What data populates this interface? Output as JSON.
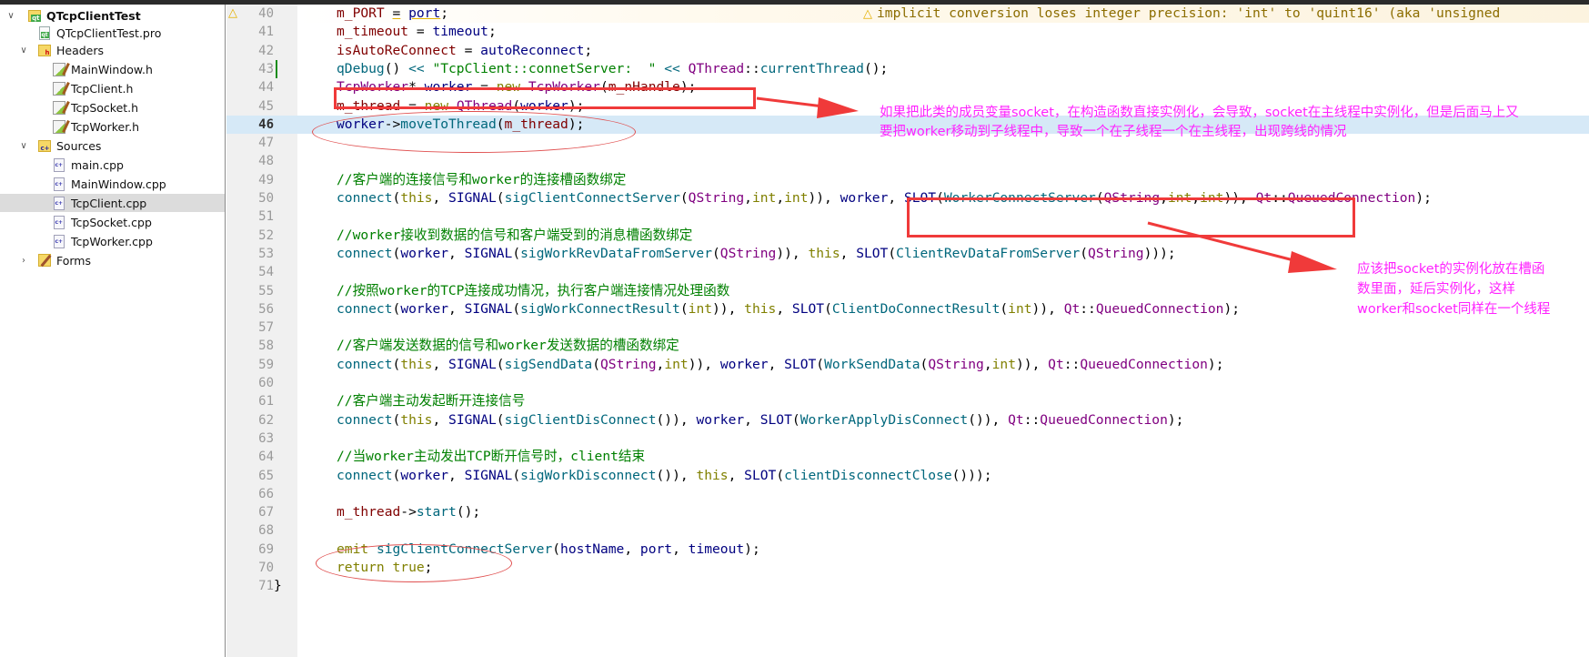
{
  "project_tree": {
    "root": {
      "label": "QTcpClientTest",
      "icon": "qt-project-icon"
    },
    "items": [
      {
        "label": "QTcpClientTest.pro",
        "icon": "qt-pro-file-icon",
        "level": 1
      },
      {
        "label": "Headers",
        "icon": "headers-folder-icon",
        "level": 1,
        "expanded": true
      },
      {
        "label": "MainWindow.h",
        "icon": "header-file-icon",
        "level": 2
      },
      {
        "label": "TcpClient.h",
        "icon": "header-file-icon",
        "level": 2
      },
      {
        "label": "TcpSocket.h",
        "icon": "header-file-icon",
        "level": 2
      },
      {
        "label": "TcpWorker.h",
        "icon": "header-file-icon",
        "level": 2
      },
      {
        "label": "Sources",
        "icon": "sources-folder-icon",
        "level": 1,
        "expanded": true
      },
      {
        "label": "main.cpp",
        "icon": "cpp-file-icon",
        "level": 2
      },
      {
        "label": "MainWindow.cpp",
        "icon": "cpp-file-icon",
        "level": 2
      },
      {
        "label": "TcpClient.cpp",
        "icon": "cpp-file-icon",
        "level": 2,
        "selected": true
      },
      {
        "label": "TcpSocket.cpp",
        "icon": "cpp-file-icon",
        "level": 2
      },
      {
        "label": "TcpWorker.cpp",
        "icon": "cpp-file-icon",
        "level": 2
      },
      {
        "label": "Forms",
        "icon": "forms-folder-icon",
        "level": 1,
        "expanded": false
      }
    ]
  },
  "editor": {
    "current_line": 46,
    "warning": {
      "line": 40,
      "text": "implicit conversion loses integer precision: 'int' to 'quint16' (aka 'unsigned"
    },
    "lines": [
      {
        "n": 40,
        "tokens": [
          [
            "t-var",
            "m_PORT"
          ],
          [
            "t-op",
            " "
          ],
          [
            "t-op t-under",
            "="
          ],
          [
            "t-op",
            " "
          ],
          [
            "t-ident t-under",
            "port"
          ],
          [
            "t-op",
            ";"
          ]
        ]
      },
      {
        "n": 41,
        "tokens": [
          [
            "t-var",
            "m_timeout"
          ],
          [
            "t-op",
            " = "
          ],
          [
            "t-ident",
            "timeout"
          ],
          [
            "t-op",
            ";"
          ]
        ]
      },
      {
        "n": 42,
        "tokens": [
          [
            "t-var",
            "isAutoReConnect"
          ],
          [
            "t-op",
            " = "
          ],
          [
            "t-ident",
            "autoReconnect"
          ],
          [
            "t-op",
            ";"
          ]
        ]
      },
      {
        "n": 43,
        "tokens": [
          [
            "t-fn",
            "qDebug"
          ],
          [
            "t-op",
            "() "
          ],
          [
            "t-fn",
            "<<"
          ],
          [
            "t-op",
            " "
          ],
          [
            "t-str",
            "\"TcpClient::connetServer:  \""
          ],
          [
            "t-op",
            " "
          ],
          [
            "t-fn",
            "<<"
          ],
          [
            "t-op",
            " "
          ],
          [
            "t-type",
            "QThread"
          ],
          [
            "t-op",
            "::"
          ],
          [
            "t-fn",
            "currentThread"
          ],
          [
            "t-op",
            "();"
          ]
        ]
      },
      {
        "n": 44,
        "tokens": [
          [
            "t-type",
            "TcpWorker"
          ],
          [
            "t-op",
            "* "
          ],
          [
            "t-ident",
            "worker"
          ],
          [
            "t-op",
            " = "
          ],
          [
            "t-kw",
            "new"
          ],
          [
            "t-op",
            " "
          ],
          [
            "t-type",
            "TcpWorker"
          ],
          [
            "t-op",
            "("
          ],
          [
            "t-var",
            "m_nHandle"
          ],
          [
            "t-op",
            ");"
          ]
        ]
      },
      {
        "n": 45,
        "tokens": [
          [
            "t-var",
            "m_thread"
          ],
          [
            "t-op",
            " = "
          ],
          [
            "t-kw",
            "new"
          ],
          [
            "t-op",
            " "
          ],
          [
            "t-type",
            "QThread"
          ],
          [
            "t-op",
            "("
          ],
          [
            "t-ident",
            "worker"
          ],
          [
            "t-op",
            ");"
          ]
        ]
      },
      {
        "n": 46,
        "tokens": [
          [
            "t-ident",
            "worker"
          ],
          [
            "t-op",
            "->"
          ],
          [
            "t-fn",
            "moveToThread"
          ],
          [
            "t-op",
            "("
          ],
          [
            "t-var",
            "m_thread"
          ],
          [
            "t-op",
            ");"
          ]
        ]
      },
      {
        "n": 47,
        "tokens": []
      },
      {
        "n": 48,
        "tokens": []
      },
      {
        "n": 49,
        "tokens": [
          [
            "t-cm",
            "//客户端的连接信号和worker的连接槽函数绑定"
          ]
        ]
      },
      {
        "n": 50,
        "tokens": [
          [
            "t-fn",
            "connect"
          ],
          [
            "t-op",
            "("
          ],
          [
            "t-kw",
            "this"
          ],
          [
            "t-op",
            ", "
          ],
          [
            "t-macro",
            "SIGNAL"
          ],
          [
            "t-op",
            "("
          ],
          [
            "t-fn",
            "sigClientConnectServer"
          ],
          [
            "t-op",
            "("
          ],
          [
            "t-type",
            "QString"
          ],
          [
            "t-op",
            ","
          ],
          [
            "t-kw",
            "int"
          ],
          [
            "t-op",
            ","
          ],
          [
            "t-kw",
            "int"
          ],
          [
            "t-op",
            ")), "
          ],
          [
            "t-ident",
            "worker"
          ],
          [
            "t-op",
            ", "
          ],
          [
            "t-macro",
            "SLOT"
          ],
          [
            "t-op",
            "("
          ],
          [
            "t-fn",
            "WorkerConnectServer"
          ],
          [
            "t-op",
            "("
          ],
          [
            "t-type",
            "QString"
          ],
          [
            "t-op",
            ","
          ],
          [
            "t-kw",
            "int"
          ],
          [
            "t-op",
            ","
          ],
          [
            "t-kw",
            "int"
          ],
          [
            "t-op",
            ")), "
          ],
          [
            "t-type",
            "Qt"
          ],
          [
            "t-op",
            "::"
          ],
          [
            "t-enum",
            "QueuedConnection"
          ],
          [
            "t-op",
            ");"
          ]
        ]
      },
      {
        "n": 51,
        "tokens": []
      },
      {
        "n": 52,
        "tokens": [
          [
            "t-cm",
            "//worker接收到数据的信号和客户端受到的消息槽函数绑定"
          ]
        ]
      },
      {
        "n": 53,
        "tokens": [
          [
            "t-fn",
            "connect"
          ],
          [
            "t-op",
            "("
          ],
          [
            "t-ident",
            "worker"
          ],
          [
            "t-op",
            ", "
          ],
          [
            "t-macro",
            "SIGNAL"
          ],
          [
            "t-op",
            "("
          ],
          [
            "t-fn",
            "sigWorkRevDataFromServer"
          ],
          [
            "t-op",
            "("
          ],
          [
            "t-type",
            "QString"
          ],
          [
            "t-op",
            ")), "
          ],
          [
            "t-kw",
            "this"
          ],
          [
            "t-op",
            ", "
          ],
          [
            "t-macro",
            "SLOT"
          ],
          [
            "t-op",
            "("
          ],
          [
            "t-fn",
            "ClientRevDataFromServer"
          ],
          [
            "t-op",
            "("
          ],
          [
            "t-type",
            "QString"
          ],
          [
            "t-op",
            ")));"
          ]
        ]
      },
      {
        "n": 54,
        "tokens": []
      },
      {
        "n": 55,
        "tokens": [
          [
            "t-cm",
            "//按照worker的TCP连接成功情况，执行客户端连接情况处理函数"
          ]
        ]
      },
      {
        "n": 56,
        "tokens": [
          [
            "t-fn",
            "connect"
          ],
          [
            "t-op",
            "("
          ],
          [
            "t-ident",
            "worker"
          ],
          [
            "t-op",
            ", "
          ],
          [
            "t-macro",
            "SIGNAL"
          ],
          [
            "t-op",
            "("
          ],
          [
            "t-fn",
            "sigWorkConnectResult"
          ],
          [
            "t-op",
            "("
          ],
          [
            "t-kw",
            "int"
          ],
          [
            "t-op",
            ")), "
          ],
          [
            "t-kw",
            "this"
          ],
          [
            "t-op",
            ", "
          ],
          [
            "t-macro",
            "SLOT"
          ],
          [
            "t-op",
            "("
          ],
          [
            "t-fn",
            "ClientDoConnectResult"
          ],
          [
            "t-op",
            "("
          ],
          [
            "t-kw",
            "int"
          ],
          [
            "t-op",
            ")), "
          ],
          [
            "t-type",
            "Qt"
          ],
          [
            "t-op",
            "::"
          ],
          [
            "t-enum",
            "QueuedConnection"
          ],
          [
            "t-op",
            ");"
          ]
        ]
      },
      {
        "n": 57,
        "tokens": []
      },
      {
        "n": 58,
        "tokens": [
          [
            "t-cm",
            "//客户端发送数据的信号和worker发送数据的槽函数绑定"
          ]
        ]
      },
      {
        "n": 59,
        "tokens": [
          [
            "t-fn",
            "connect"
          ],
          [
            "t-op",
            "("
          ],
          [
            "t-kw",
            "this"
          ],
          [
            "t-op",
            ", "
          ],
          [
            "t-macro",
            "SIGNAL"
          ],
          [
            "t-op",
            "("
          ],
          [
            "t-fn",
            "sigSendData"
          ],
          [
            "t-op",
            "("
          ],
          [
            "t-type",
            "QString"
          ],
          [
            "t-op",
            ","
          ],
          [
            "t-kw",
            "int"
          ],
          [
            "t-op",
            ")), "
          ],
          [
            "t-ident",
            "worker"
          ],
          [
            "t-op",
            ", "
          ],
          [
            "t-macro",
            "SLOT"
          ],
          [
            "t-op",
            "("
          ],
          [
            "t-fn",
            "WorkSendData"
          ],
          [
            "t-op",
            "("
          ],
          [
            "t-type",
            "QString"
          ],
          [
            "t-op",
            ","
          ],
          [
            "t-kw",
            "int"
          ],
          [
            "t-op",
            ")), "
          ],
          [
            "t-type",
            "Qt"
          ],
          [
            "t-op",
            "::"
          ],
          [
            "t-enum",
            "QueuedConnection"
          ],
          [
            "t-op",
            ");"
          ]
        ]
      },
      {
        "n": 60,
        "tokens": []
      },
      {
        "n": 61,
        "tokens": [
          [
            "t-cm",
            "//客户端主动发起断开连接信号"
          ]
        ]
      },
      {
        "n": 62,
        "tokens": [
          [
            "t-fn",
            "connect"
          ],
          [
            "t-op",
            "("
          ],
          [
            "t-kw",
            "this"
          ],
          [
            "t-op",
            ", "
          ],
          [
            "t-macro",
            "SIGNAL"
          ],
          [
            "t-op",
            "("
          ],
          [
            "t-fn",
            "sigClientDisConnect"
          ],
          [
            "t-op",
            "()), "
          ],
          [
            "t-ident",
            "worker"
          ],
          [
            "t-op",
            ", "
          ],
          [
            "t-macro",
            "SLOT"
          ],
          [
            "t-op",
            "("
          ],
          [
            "t-fn",
            "WorkerApplyDisConnect"
          ],
          [
            "t-op",
            "()), "
          ],
          [
            "t-type",
            "Qt"
          ],
          [
            "t-op",
            "::"
          ],
          [
            "t-enum",
            "QueuedConnection"
          ],
          [
            "t-op",
            ");"
          ]
        ]
      },
      {
        "n": 63,
        "tokens": []
      },
      {
        "n": 64,
        "tokens": [
          [
            "t-cm",
            "//当worker主动发出TCP断开信号时，client结束"
          ]
        ]
      },
      {
        "n": 65,
        "tokens": [
          [
            "t-fn",
            "connect"
          ],
          [
            "t-op",
            "("
          ],
          [
            "t-ident",
            "worker"
          ],
          [
            "t-op",
            ", "
          ],
          [
            "t-macro",
            "SIGNAL"
          ],
          [
            "t-op",
            "("
          ],
          [
            "t-fn",
            "sigWorkDisconnect"
          ],
          [
            "t-op",
            "()), "
          ],
          [
            "t-kw",
            "this"
          ],
          [
            "t-op",
            ", "
          ],
          [
            "t-macro",
            "SLOT"
          ],
          [
            "t-op",
            "("
          ],
          [
            "t-fn",
            "clientDisconnectClose"
          ],
          [
            "t-op",
            "()));"
          ]
        ]
      },
      {
        "n": 66,
        "tokens": []
      },
      {
        "n": 67,
        "tokens": [
          [
            "t-var",
            "m_thread"
          ],
          [
            "t-op",
            "->"
          ],
          [
            "t-fn",
            "start"
          ],
          [
            "t-op",
            "();"
          ]
        ]
      },
      {
        "n": 68,
        "tokens": []
      },
      {
        "n": 69,
        "tokens": [
          [
            "t-kw",
            "emit"
          ],
          [
            "t-op",
            " "
          ],
          [
            "t-fn",
            "sigClientConnectServer"
          ],
          [
            "t-op",
            "("
          ],
          [
            "t-ident",
            "hostName"
          ],
          [
            "t-op",
            ", "
          ],
          [
            "t-ident",
            "port"
          ],
          [
            "t-op",
            ", "
          ],
          [
            "t-ident",
            "timeout"
          ],
          [
            "t-op",
            ");"
          ]
        ]
      },
      {
        "n": 70,
        "tokens": [
          [
            "t-kw",
            "return"
          ],
          [
            "t-op",
            " "
          ],
          [
            "t-kw",
            "true"
          ],
          [
            "t-op",
            ";"
          ]
        ]
      },
      {
        "n": 71,
        "tokens": [
          [
            "t-op",
            "}"
          ]
        ],
        "indent": 0
      }
    ]
  },
  "annotations": {
    "note1_line1": "如果把此类的成员变量socket，在构造函数直接实例化，会导致，socket在主线程中实例化，但是后面马上又",
    "note1_line2": "要把worker移动到子线程中，导致一个在子线程一个在主线程，出现跨线的情况",
    "note2_line1": "应该把socket的实例化放在槽函",
    "note2_line2": "数里面，延后实例化，这样",
    "note2_line3": "worker和socket同样在一个线程",
    "color": "#ff22ff",
    "box_color": "#f03a3a"
  }
}
